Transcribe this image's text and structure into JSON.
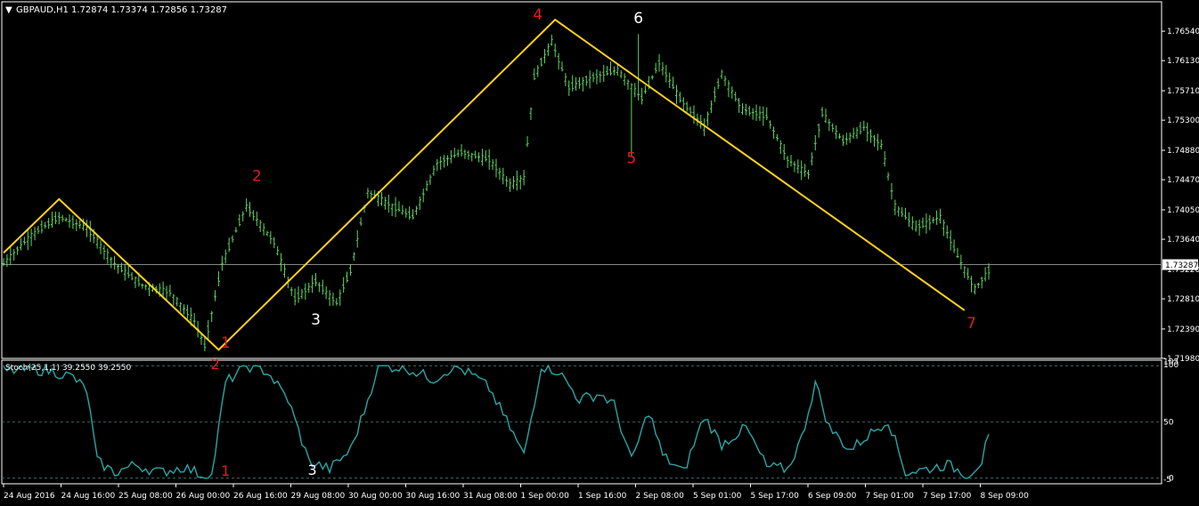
{
  "colors": {
    "background": "#000000",
    "frame": "#ffffff",
    "candle": "#5fd35f",
    "zigzag": "#ffd21a",
    "stoch": "#2aa6a6",
    "red_label": "#e01e1e",
    "white_label": "#ffffff"
  },
  "header": {
    "symbol_tf": "GBPAUD,H1",
    "ohlc": "1.72874 1.73374 1.72856 1.73287"
  },
  "current_price_tag": "1.73287",
  "stoch_header": "Stoch(25,1,1) 39.2550 39.2550",
  "stoch_levels": [
    "105",
    "100",
    "50",
    "0",
    "-5"
  ],
  "chart_data": [
    {
      "type": "line",
      "subtype": "ohlc_bars",
      "symbol": "GBPAUD",
      "timeframe": "H1",
      "ylim": [
        1.7198,
        1.7695
      ],
      "y_ticks": [
        1.7654,
        1.7613,
        1.7571,
        1.753,
        1.7488,
        1.7447,
        1.7405,
        1.7364,
        1.7322,
        1.7281,
        1.7239,
        1.7198
      ],
      "y_tick_labels": [
        "1.76540",
        "1.76130",
        "1.75710",
        "1.75300",
        "1.74880",
        "1.74470",
        "1.74050",
        "1.73640",
        "1.73220",
        "1.72810",
        "1.72390",
        "1.71980"
      ],
      "x_ticks": [
        "24 Aug 2016",
        "24 Aug 16:00",
        "25 Aug 08:00",
        "26 Aug 00:00",
        "26 Aug 16:00",
        "29 Aug 08:00",
        "30 Aug 00:00",
        "30 Aug 16:00",
        "31 Aug 08:00",
        "1 Sep 00:00",
        "1 Sep 16:00",
        "2 Sep 08:00",
        "5 Sep 01:00",
        "5 Sep 17:00",
        "6 Sep 09:00",
        "7 Sep 01:00",
        "7 Sep 17:00",
        "8 Sep 09:00"
      ],
      "current_price": 1.73287,
      "keypoints": [
        {
          "t": 0,
          "p": 1.733
        },
        {
          "t": 8,
          "p": 1.737
        },
        {
          "t": 16,
          "p": 1.7395
        },
        {
          "t": 24,
          "p": 1.738
        },
        {
          "t": 32,
          "p": 1.733
        },
        {
          "t": 40,
          "p": 1.73
        },
        {
          "t": 48,
          "p": 1.729
        },
        {
          "t": 55,
          "p": 1.725
        },
        {
          "t": 58,
          "p": 1.7215
        },
        {
          "t": 63,
          "p": 1.733
        },
        {
          "t": 70,
          "p": 1.741
        },
        {
          "t": 78,
          "p": 1.736
        },
        {
          "t": 84,
          "p": 1.728
        },
        {
          "t": 90,
          "p": 1.7305
        },
        {
          "t": 96,
          "p": 1.7275
        },
        {
          "t": 100,
          "p": 1.732
        },
        {
          "t": 105,
          "p": 1.743
        },
        {
          "t": 112,
          "p": 1.741
        },
        {
          "t": 118,
          "p": 1.7395
        },
        {
          "t": 125,
          "p": 1.747
        },
        {
          "t": 132,
          "p": 1.7485
        },
        {
          "t": 140,
          "p": 1.7475
        },
        {
          "t": 146,
          "p": 1.744
        },
        {
          "t": 150,
          "p": 1.745
        },
        {
          "t": 153,
          "p": 1.759
        },
        {
          "t": 158,
          "p": 1.764
        },
        {
          "t": 163,
          "p": 1.7575
        },
        {
          "t": 170,
          "p": 1.759
        },
        {
          "t": 177,
          "p": 1.76
        },
        {
          "t": 184,
          "p": 1.756
        },
        {
          "t": 189,
          "p": 1.761
        },
        {
          "t": 195,
          "p": 1.756
        },
        {
          "t": 202,
          "p": 1.752
        },
        {
          "t": 207,
          "p": 1.7595
        },
        {
          "t": 213,
          "p": 1.7545
        },
        {
          "t": 220,
          "p": 1.7535
        },
        {
          "t": 226,
          "p": 1.7475
        },
        {
          "t": 232,
          "p": 1.7455
        },
        {
          "t": 236,
          "p": 1.754
        },
        {
          "t": 242,
          "p": 1.75
        },
        {
          "t": 248,
          "p": 1.752
        },
        {
          "t": 253,
          "p": 1.7495
        },
        {
          "t": 257,
          "p": 1.741
        },
        {
          "t": 263,
          "p": 1.738
        },
        {
          "t": 270,
          "p": 1.7395
        },
        {
          "t": 275,
          "p": 1.734
        },
        {
          "t": 280,
          "p": 1.7295
        },
        {
          "t": 284,
          "p": 1.732
        }
      ],
      "zigzag": [
        {
          "t": 0,
          "p": 1.7345
        },
        {
          "t": 16,
          "p": 1.742
        },
        {
          "t": 62,
          "p": 1.721
        },
        {
          "t": 159,
          "p": 1.767
        },
        {
          "t": 277,
          "p": 1.7265
        }
      ],
      "wave_labels": [
        {
          "text": "1",
          "t": 64,
          "p": 1.7213,
          "color": "red"
        },
        {
          "text": "2",
          "t": 73,
          "p": 1.7445,
          "color": "red"
        },
        {
          "text": "3",
          "t": 90,
          "p": 1.7245,
          "color": "white"
        },
        {
          "text": "4",
          "t": 154,
          "p": 1.767,
          "color": "red"
        },
        {
          "text": "5",
          "t": 181,
          "p": 1.747,
          "color": "red"
        },
        {
          "text": "6",
          "t": 183,
          "p": 1.7665,
          "color": "white"
        },
        {
          "text": "7",
          "t": 279,
          "p": 1.724,
          "color": "red"
        }
      ]
    },
    {
      "type": "line",
      "name": "Stoch(25,1,1)",
      "value": 39.255,
      "ylim": [
        -5,
        105
      ],
      "levels": [
        100,
        50,
        0
      ],
      "keypoints": [
        {
          "t": 0,
          "v": 95
        },
        {
          "t": 8,
          "v": 97
        },
        {
          "t": 14,
          "v": 95
        },
        {
          "t": 20,
          "v": 90
        },
        {
          "t": 24,
          "v": 78
        },
        {
          "t": 27,
          "v": 15
        },
        {
          "t": 32,
          "v": 5
        },
        {
          "t": 38,
          "v": 12
        },
        {
          "t": 45,
          "v": 5
        },
        {
          "t": 52,
          "v": 10
        },
        {
          "t": 57,
          "v": 3
        },
        {
          "t": 60,
          "v": 2
        },
        {
          "t": 64,
          "v": 85
        },
        {
          "t": 70,
          "v": 100
        },
        {
          "t": 76,
          "v": 95
        },
        {
          "t": 82,
          "v": 70
        },
        {
          "t": 88,
          "v": 15
        },
        {
          "t": 94,
          "v": 8
        },
        {
          "t": 100,
          "v": 25
        },
        {
          "t": 104,
          "v": 60
        },
        {
          "t": 108,
          "v": 100
        },
        {
          "t": 116,
          "v": 98
        },
        {
          "t": 124,
          "v": 88
        },
        {
          "t": 130,
          "v": 100
        },
        {
          "t": 136,
          "v": 90
        },
        {
          "t": 140,
          "v": 80
        },
        {
          "t": 146,
          "v": 45
        },
        {
          "t": 150,
          "v": 20
        },
        {
          "t": 155,
          "v": 100
        },
        {
          "t": 160,
          "v": 95
        },
        {
          "t": 166,
          "v": 70
        },
        {
          "t": 172,
          "v": 75
        },
        {
          "t": 176,
          "v": 65
        },
        {
          "t": 181,
          "v": 15
        },
        {
          "t": 186,
          "v": 60
        },
        {
          "t": 190,
          "v": 20
        },
        {
          "t": 196,
          "v": 5
        },
        {
          "t": 202,
          "v": 55
        },
        {
          "t": 207,
          "v": 30
        },
        {
          "t": 214,
          "v": 45
        },
        {
          "t": 220,
          "v": 10
        },
        {
          "t": 226,
          "v": 8
        },
        {
          "t": 230,
          "v": 35
        },
        {
          "t": 234,
          "v": 85
        },
        {
          "t": 238,
          "v": 45
        },
        {
          "t": 244,
          "v": 25
        },
        {
          "t": 250,
          "v": 40
        },
        {
          "t": 255,
          "v": 52
        },
        {
          "t": 260,
          "v": 5
        },
        {
          "t": 266,
          "v": 8
        },
        {
          "t": 272,
          "v": 12
        },
        {
          "t": 278,
          "v": 3
        },
        {
          "t": 282,
          "v": 15
        },
        {
          "t": 284,
          "v": 39.255
        }
      ],
      "wave_labels": [
        {
          "text": "1",
          "t": 64,
          "v": 2,
          "color": "red"
        },
        {
          "text": "2",
          "t": 61,
          "v": 97,
          "color": "red"
        },
        {
          "text": "3",
          "t": 89,
          "v": 3,
          "color": "white"
        }
      ]
    }
  ]
}
